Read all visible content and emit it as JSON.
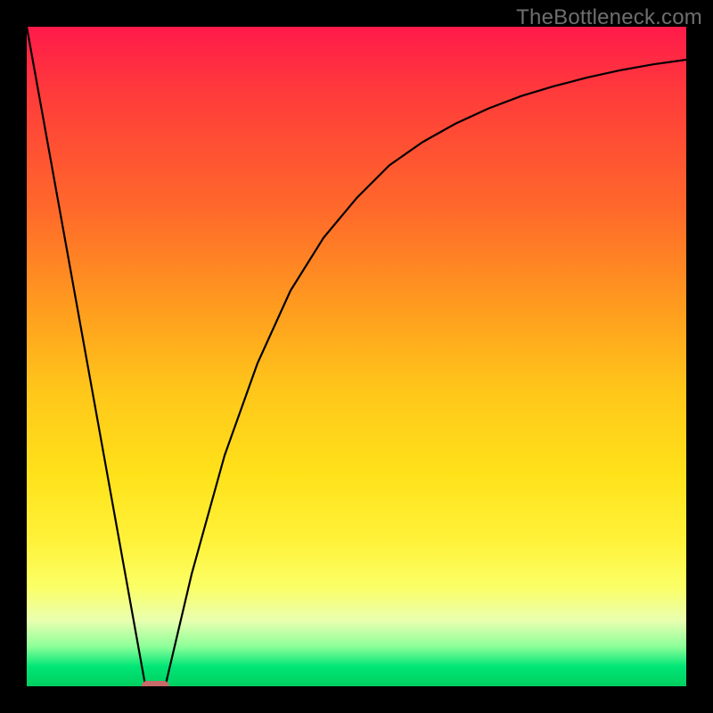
{
  "watermark": "TheBottleneck.com",
  "chart_data": {
    "type": "line",
    "title": "",
    "xlabel": "",
    "ylabel": "",
    "xlim": [
      0,
      100
    ],
    "ylim": [
      0,
      100
    ],
    "series": [
      {
        "name": "left-slope",
        "x": [
          0,
          18
        ],
        "values": [
          100,
          0
        ]
      },
      {
        "name": "right-curve",
        "x": [
          21,
          25,
          30,
          35,
          40,
          45,
          50,
          55,
          60,
          65,
          70,
          75,
          80,
          85,
          90,
          95,
          100
        ],
        "values": [
          0,
          17,
          35,
          49,
          60,
          68,
          74,
          79,
          82.5,
          85.3,
          87.6,
          89.5,
          91,
          92.3,
          93.4,
          94.3,
          95
        ]
      }
    ],
    "markers": [
      {
        "name": "red-pill",
        "x": 19.5,
        "y": 0,
        "width_pct": 4.2,
        "color": "#c96a6a"
      }
    ],
    "background_gradient": {
      "top": "#ff1a4a",
      "mid": "#ffe21a",
      "bottom": "#00d060"
    }
  }
}
